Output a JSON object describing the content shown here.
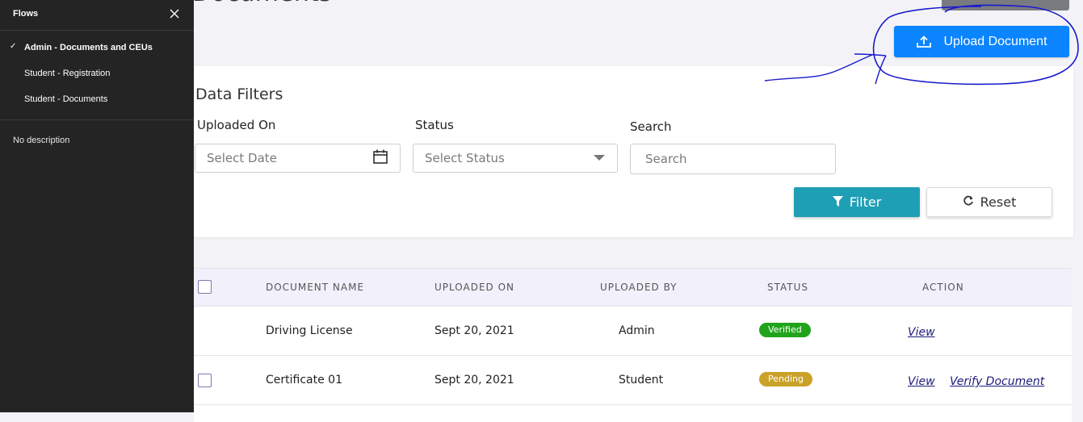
{
  "page": {
    "title": "Documents",
    "upload_button": "Upload Document"
  },
  "filters": {
    "heading": "Data Filters",
    "uploaded_on_label": "Uploaded On",
    "date_placeholder": "Select Date",
    "status_label": "Status",
    "status_placeholder": "Select Status",
    "search_label": "Search",
    "search_placeholder": "Search",
    "filter_button": "Filter",
    "reset_button": "Reset"
  },
  "table": {
    "columns": [
      "DOCUMENT NAME",
      "UPLOADED ON",
      "UPLOADED BY",
      "STATUS",
      "ACTION"
    ],
    "rows": [
      {
        "name": "Driving License",
        "uploaded_on": "Sept 20, 2021",
        "uploaded_by": "Admin",
        "status": "Verified",
        "status_color": "#21a41b",
        "actions": [
          "View"
        ]
      },
      {
        "name": "Certificate 01",
        "uploaded_on": "Sept 20, 2021",
        "uploaded_by": "Student",
        "status": "Pending",
        "status_color": "#c9a227",
        "actions": [
          "View",
          "Verify Document"
        ]
      }
    ]
  },
  "sidebar": {
    "title": "Flows",
    "items": [
      {
        "label": "Admin - Documents and CEUs",
        "checked": true
      },
      {
        "label": "Student - Registration",
        "checked": false
      },
      {
        "label": "Student - Documents",
        "checked": false
      }
    ],
    "description": "No description"
  },
  "colors": {
    "primary": "#0a84ff",
    "filter_button": "#1f9fb5",
    "sidebar_bg": "#242424",
    "annotation": "#1a1acc"
  }
}
